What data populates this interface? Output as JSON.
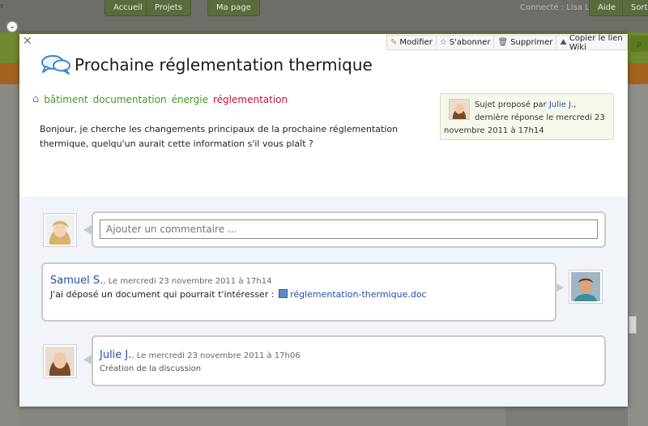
{
  "nav": {
    "tabs": [
      "Accueil",
      "Projets",
      "Ma page"
    ],
    "user_text": "Connecté : Lisa L.",
    "help_label": "Aide",
    "logout_label": "Sortir"
  },
  "modal": {
    "close_icon": "close-icon",
    "actions": [
      {
        "label": "Modifier",
        "icon": "pencil-icon"
      },
      {
        "label": "S'abonner",
        "icon": "star-icon"
      },
      {
        "label": "Supprimer",
        "icon": "trash-icon"
      },
      {
        "label": "Copier le lien Wiki",
        "icon": "wiki-link-icon"
      }
    ],
    "title": "Prochaine réglementation thermique",
    "tags": [
      {
        "label": "bâtiment",
        "color": "#3d9c1c"
      },
      {
        "label": "documentation",
        "color": "#3d9c1c"
      },
      {
        "label": "énergie",
        "color": "#3d9c1c"
      },
      {
        "label": "réglementation",
        "color": "#c8102e"
      }
    ],
    "meta": {
      "prefix": "Sujet proposé par",
      "author": "Julie J.",
      "suffix": ", dernière réponse le mercredi 23 novembre 2011 à 17h14"
    },
    "body": "Bonjour, je cherche les changements principaux de la prochaine réglementation thermique, quelqu'un aurait cette information s'il vous plaît ?"
  },
  "comments": {
    "add_placeholder": "Ajouter un commentaire ...",
    "items": [
      {
        "author": "Samuel S.",
        "date": ", Le mercredi 23 novembre 2011 à 17h14",
        "text": "J'ai déposé un document qui pourrait t'intéresser :",
        "attachment": "réglementation-thermique.doc"
      },
      {
        "author": "Julie J.",
        "date": ", Le mercredi 23 novembre 2011 à 17h06",
        "text": "Création de la discussion"
      }
    ]
  },
  "colors": {
    "link": "#2050a8",
    "tag_green": "#3d9c1c",
    "tag_red": "#c8102e",
    "brand_green": "#6f8a2e"
  }
}
